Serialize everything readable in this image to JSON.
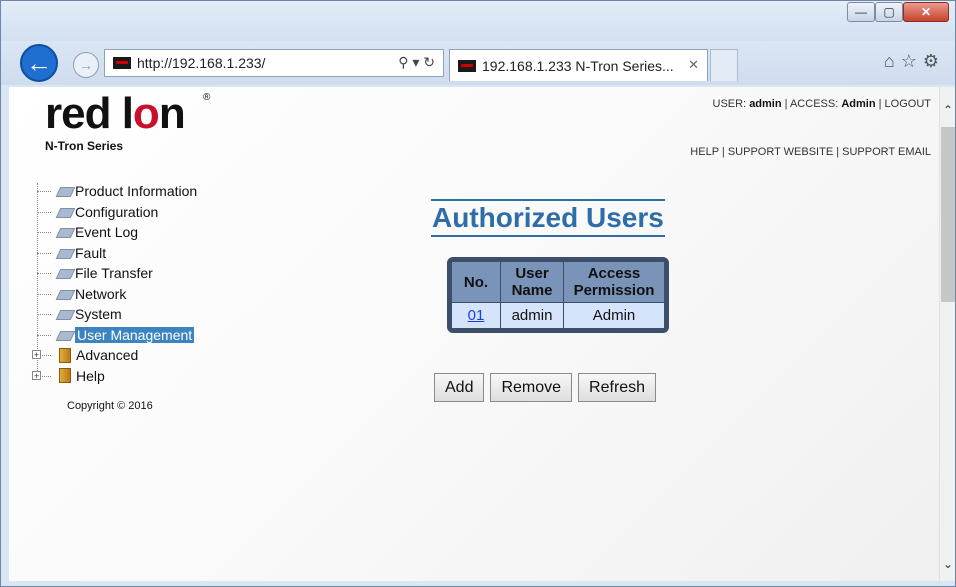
{
  "browser": {
    "url": "http://192.168.1.233/",
    "tab_title": "192.168.1.233 N-Tron Series...",
    "tab_close": "✕",
    "window_buttons": [
      "—",
      "▢",
      "✕"
    ],
    "toolbar_icons": [
      "home-icon",
      "star-icon",
      "gear-icon"
    ]
  },
  "header": {
    "logo_text_a": "red l",
    "logo_text_o": "o",
    "logo_text_b": "n",
    "logo_registered": "®",
    "logo_subtitle": "N-Tron Series",
    "user_label": "USER:",
    "user_value": "admin",
    "access_label": "ACCESS:",
    "access_value": "Admin",
    "logout": "LOGOUT",
    "help": "HELP",
    "support_website": "SUPPORT WEBSITE",
    "support_email": "SUPPORT EMAIL",
    "separator": "|"
  },
  "sidebar": {
    "items": [
      {
        "label": "Product Information"
      },
      {
        "label": "Configuration"
      },
      {
        "label": "Event Log"
      },
      {
        "label": "Fault"
      },
      {
        "label": "File Transfer"
      },
      {
        "label": "Network"
      },
      {
        "label": "System"
      },
      {
        "label": "User Management"
      },
      {
        "label": "Advanced"
      },
      {
        "label": "Help"
      }
    ],
    "selected": "User Management",
    "expander": "+",
    "copyright": "Copyright © 2016"
  },
  "main": {
    "title": "Authorized Users",
    "table": {
      "headers": [
        "No.",
        "User Name",
        "Access Permission"
      ],
      "rows": [
        [
          "01",
          "admin",
          "Admin"
        ]
      ]
    },
    "buttons": {
      "add": "Add",
      "remove": "Remove",
      "refresh": "Refresh"
    }
  },
  "colors": {
    "accent": "#2f6da8",
    "brand_red": "#c8102e",
    "table_header": "#7a93b8",
    "table_cell": "#d6e4fb",
    "selection": "#3b84c0"
  }
}
